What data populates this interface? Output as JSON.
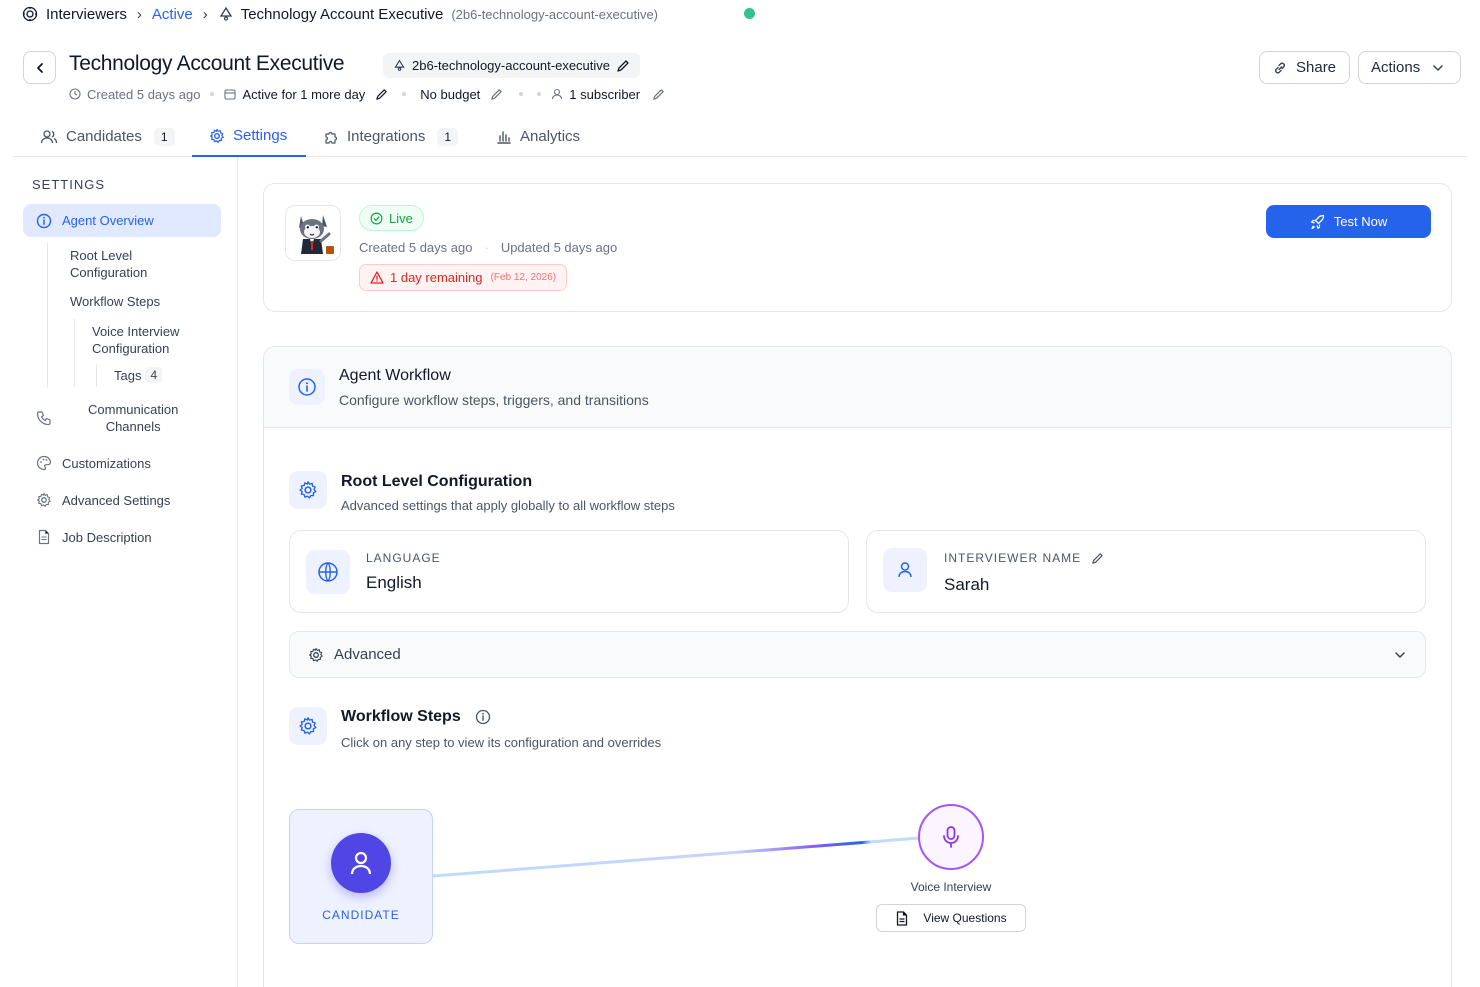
{
  "breadcrumb": {
    "items": [
      "Interviewers",
      "Active",
      "Technology Account Executive"
    ],
    "slug": "(2b6-technology-account-executive)"
  },
  "header": {
    "title": "Technology Account Executive",
    "slug": "2b6-technology-account-executive",
    "created": "Created 5 days ago",
    "active_for": "Active for 1 more day",
    "budget": "No budget",
    "subscribers": "1 subscriber",
    "share_label": "Share",
    "actions_label": "Actions"
  },
  "tabs": [
    {
      "label": "Candidates",
      "count": "1"
    },
    {
      "label": "Settings"
    },
    {
      "label": "Integrations",
      "count": "1"
    },
    {
      "label": "Analytics"
    }
  ],
  "sidebar": {
    "title": "SETTINGS",
    "agent_overview": "Agent Overview",
    "root_level_1": "Root Level",
    "root_level_2": "Configuration",
    "workflow_steps": "Workflow Steps",
    "voice_config_1": "Voice Interview",
    "voice_config_2": "Configuration",
    "tags": "Tags",
    "tags_count": "4",
    "comm_1": "Communication",
    "comm_2": "Channels",
    "customizations": "Customizations",
    "advanced_settings": "Advanced Settings",
    "job_description": "Job Description"
  },
  "agent_card": {
    "status": "Live",
    "created": "Created 5 days ago",
    "updated": "Updated 5 days ago",
    "remaining": "1 day remaining",
    "remaining_date": "(Feb 12, 2026)",
    "test_label": "Test Now"
  },
  "workflow": {
    "title": "Agent Workflow",
    "subtitle": "Configure workflow steps, triggers, and transitions",
    "root_title": "Root Level Configuration",
    "root_subtitle": "Advanced settings that apply globally to all workflow steps",
    "language_label": "LANGUAGE",
    "language_value": "English",
    "interviewer_label": "INTERVIEWER NAME",
    "interviewer_value": "Sarah",
    "advanced_label": "Advanced",
    "steps_title": "Workflow Steps",
    "steps_subtitle": "Click on any step to view its configuration and overrides",
    "candidate_label": "CANDIDATE",
    "voice_label": "Voice Interview",
    "view_questions": "View Questions"
  },
  "colors": {
    "accent": "#2563eb",
    "live": "#16a34a",
    "warning": "#dc2626",
    "status_dot": "#34c38f",
    "voice_node": "#9333ea"
  }
}
